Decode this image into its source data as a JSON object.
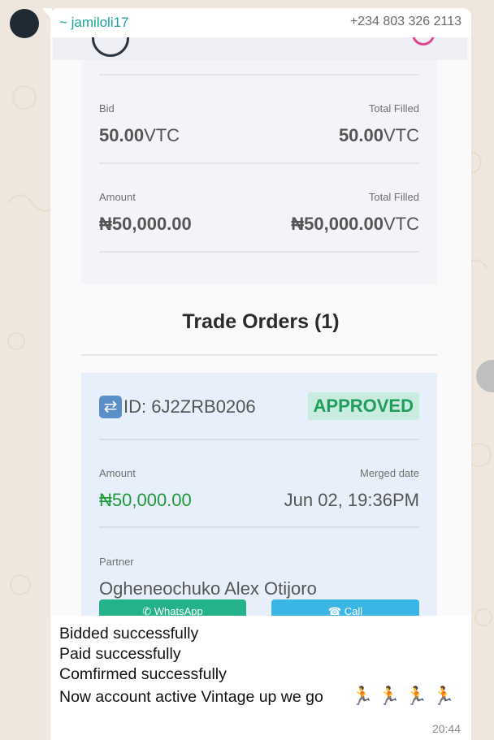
{
  "chat": {
    "sender": "~ jamiloli17",
    "phone": "+234 803 326 2113",
    "time": "20:44",
    "message_lines": [
      "Bidded successfully",
      "Paid successfully",
      "Comfirmed successfully",
      "Now account active Vintage up we go"
    ],
    "emoji": "🏃🏃🏃🏃"
  },
  "screenshot": {
    "summary": {
      "bid_label": "Bid",
      "bid_value": "50.00",
      "bid_unit": "VTC",
      "bid_filled_label": "Total Filled",
      "bid_filled_value": "50.00",
      "bid_filled_unit": "VTC",
      "amount_label": "Amount",
      "amount_value": "₦50,000.00",
      "amount_filled_label": "Total Filled",
      "amount_filled_value": "₦50,000.00",
      "amount_filled_unit": "VTC"
    },
    "trade_orders_title": "Trade Orders (1)",
    "order": {
      "id": "ID: 6J2ZRB0206",
      "status": "APPROVED",
      "amount_label": "Amount",
      "amount_value": "₦50,000.00",
      "merged_label": "Merged date",
      "merged_value": "Jun 02, 19:36PM",
      "partner_label": "Partner",
      "partner_value": "Ogheneochuko Alex Otijoro",
      "whatsapp_label": "WhatsApp",
      "call_label": "Call"
    }
  },
  "colors": {
    "sender": "#1aa39b",
    "approved_bg": "#c9ebe0",
    "approved_text": "#1f9d5a",
    "amount_green": "#1f9a3b",
    "whatsapp_btn": "#23b28a",
    "call_btn": "#3bb4e6"
  }
}
